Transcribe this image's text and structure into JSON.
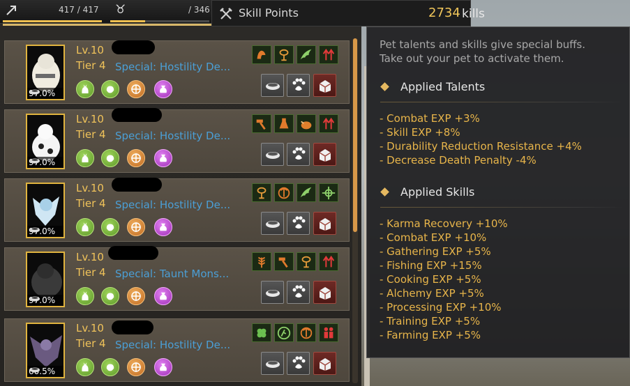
{
  "status": {
    "hp": "417 / 417",
    "hp_fill": 1.0,
    "weight": "/ 346",
    "weight_fill": 0.35
  },
  "skill_points": {
    "label": "Skill Points",
    "value": "2734"
  },
  "panel_title_tail": "kills",
  "colors": {
    "gold": "#f0c35a",
    "blue": "#4b9fd6",
    "effect": "#e8b54a"
  },
  "pets": [
    {
      "level": "Lv.10",
      "tier": "Tier 4",
      "special": "Special: Hostility De...",
      "hunger": "97.0%",
      "talents": [
        "hoof-talent-icon",
        "lasso-talent-icon",
        "wing-talent-icon",
        "red-arrows-talent-icon"
      ]
    },
    {
      "level": "Lv.10",
      "tier": "Tier 4",
      "special": "Special: Hostility De...",
      "hunger": "97.0%",
      "talents": [
        "hammer-talent-icon",
        "flask-talent-icon",
        "cooked-meat-talent-icon",
        "red-arrows-talent-icon"
      ]
    },
    {
      "level": "Lv.10",
      "tier": "Tier 4",
      "special": "Special: Hostility De...",
      "hunger": "97.0%",
      "talents": [
        "lasso-talent-icon",
        "pickaxe-talent-icon",
        "wing-talent-icon",
        "target-talent-icon"
      ]
    },
    {
      "level": "Lv.10",
      "tier": "Tier 4",
      "special": "Special: Taunt Mons...",
      "hunger": "97.0%",
      "talents": [
        "wheat-talent-icon",
        "hammer-talent-icon",
        "lasso-talent-icon",
        "red-arrows-talent-icon"
      ]
    },
    {
      "level": "Lv.10",
      "tier": "Tier 4",
      "special": "Special: Hostility De...",
      "hunger": "60.5%",
      "talents": [
        "clover-talent-icon",
        "runner-talent-icon",
        "pickaxe-talent-icon",
        "red-figures-talent-icon"
      ]
    }
  ],
  "info": {
    "description": "Pet talents and skills give special buffs. Take out your pet to activate them.",
    "talents_header": "Applied Talents",
    "talents": [
      "- Combat EXP +3%",
      "- Skill EXP +8%",
      "- Durability Reduction Resistance +4%",
      "- Decrease Death Penalty -4%"
    ],
    "skills_header": "Applied Skills",
    "skills": [
      "- Karma Recovery +10%",
      "- Combat EXP +10%",
      "- Gathering EXP +5%",
      "- Fishing EXP +15%",
      "- Cooking EXP +5%",
      "- Alchemy EXP +5%",
      "- Processing EXP +10%",
      "- Training EXP +5%",
      "- Farming EXP +5%"
    ]
  }
}
